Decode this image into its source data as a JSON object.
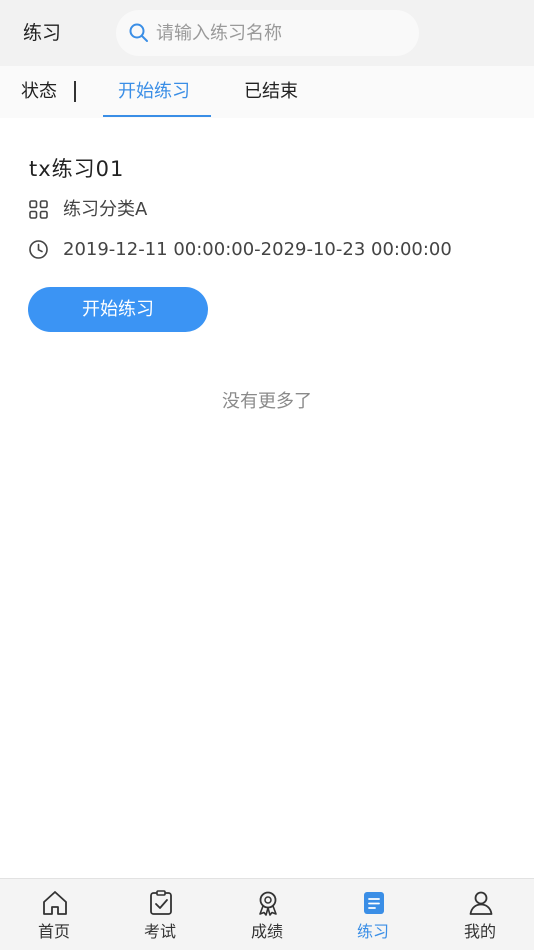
{
  "header": {
    "title": "练习",
    "search": {
      "placeholder": "请输入练习名称",
      "value": ""
    }
  },
  "tabs": {
    "status_label": "状态",
    "items": [
      {
        "label": "开始练习",
        "active": true
      },
      {
        "label": "已结束",
        "active": false
      }
    ]
  },
  "practice": {
    "title": "tx练习01",
    "category": "练习分类A",
    "time_range": "2019-12-11 00:00:00-2029-10-23 00:00:00",
    "button_label": "开始练习"
  },
  "list_end_text": "没有更多了",
  "bottom_nav": {
    "items": [
      {
        "label": "首页",
        "icon": "home-icon",
        "active": false
      },
      {
        "label": "考试",
        "icon": "exam-clipboard-icon",
        "active": false
      },
      {
        "label": "成绩",
        "icon": "award-badge-icon",
        "active": false
      },
      {
        "label": "练习",
        "icon": "practice-doc-icon",
        "active": true
      },
      {
        "label": "我的",
        "icon": "user-icon",
        "active": false
      }
    ]
  },
  "colors": {
    "accent": "#3a8ee6",
    "button": "#3b94f4",
    "header_bg": "#f2f2f2"
  }
}
